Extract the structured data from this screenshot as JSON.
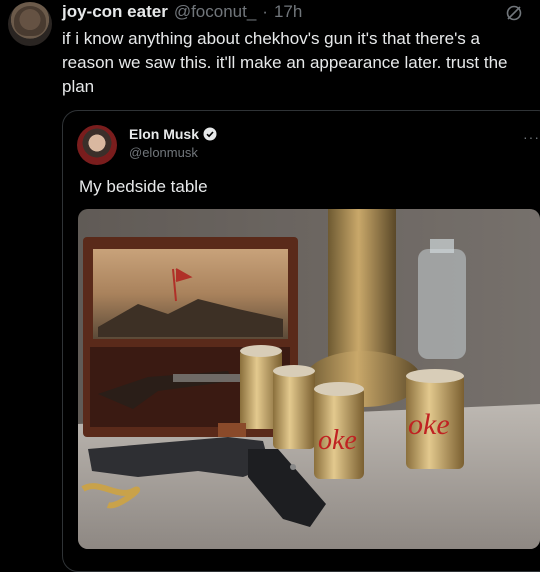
{
  "tweet": {
    "display_name": "joy-con eater",
    "handle": "@foconut_",
    "separator": "·",
    "time": "17h",
    "text": "if i know anything about chekhov's gun it's that there's a reason we saw this. it'll make an appearance later. trust the plan",
    "grok_icon": "grok-icon"
  },
  "quoted": {
    "display_name": "Elon Musk",
    "handle": "@elonmusk",
    "verified_icon": "verified-badge-icon",
    "more": "···",
    "text": "My bedside table",
    "photo": {
      "can_text_left": "oke",
      "can_text_right": "oke"
    }
  },
  "colors": {
    "background": "#000000",
    "text": "#e7e9ea",
    "muted": "#71767b",
    "border": "#2f3336"
  }
}
